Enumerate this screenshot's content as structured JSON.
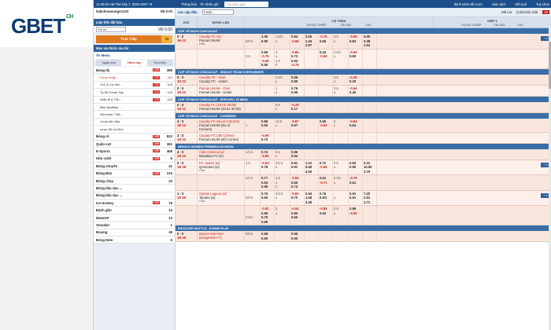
{
  "brand": {
    "name": "GBET",
    "domain": ".CH"
  },
  "topbar": {
    "time": "11:26:00 AM Thứ bảy 7, 2025 GMT +8",
    "notice_label": "Thông báo",
    "notice_text": "Tin nhắn gửi",
    "search_placeholder": "Tìm kiếm giải",
    "links": [
      "danh sách đã cược",
      "Giao dịch",
      "Kết quả",
      "Tuỳ chọn"
    ]
  },
  "sidebar": {
    "username": "0abchoamungen123",
    "balance": "VĐ 0.00",
    "credit_label": "Tín cực",
    "bet_slip_title": "Làm tiền đặt bảo",
    "bet_select": "Tối cả",
    "bet_amount": "VĐ 0.00",
    "bet_button": "Trực Tiếp",
    "bet_count": "30",
    "fav_title": "Mục ưu thích của tôi",
    "menu_title": "Ẩn Menu",
    "tabs": [
      "Ngày mai",
      "Hôm nay",
      "Trực tiếp"
    ],
    "sports": [
      {
        "name": "Bóng đá",
        "live": "LIVE",
        "count": "389",
        "style": "bold"
      },
      {
        "name": "Cược chấp ...",
        "live": "LIVE",
        "count": "334",
        "style": "sub hl"
      },
      {
        "name": "1X2 & Cơ Hội ...",
        "live": "LIVE",
        "count": "116",
        "style": "sub"
      },
      {
        "name": "Tỷ Số Chính Xác",
        "live": "LIVE",
        "count": "119",
        "style": "sub"
      },
      {
        "name": "chẵn lẻ & Tổn ...",
        "live": "LIVE",
        "count": "123",
        "style": "sub"
      },
      {
        "name": "Bàn đầu/Bàn ...",
        "live": "",
        "count": "",
        "style": "sub"
      },
      {
        "name": "Nửa trận / Toả...",
        "live": "",
        "count": "",
        "style": "sub"
      },
      {
        "name": "Cược liên tiếp",
        "live": "",
        "count": "",
        "style": "sub"
      },
      {
        "name": "cược đôi và đích",
        "live": "",
        "count": "",
        "style": "sub"
      },
      {
        "name": "Bóng rổ",
        "live": "LIVE",
        "count": "822",
        "style": "bold"
      },
      {
        "name": "Quần vợt",
        "live": "LIVE",
        "count": "361",
        "style": "bold"
      },
      {
        "name": "E-Sports",
        "live": "LIVE",
        "count": "465",
        "style": "bold"
      },
      {
        "name": "Hôn cnkê",
        "live": "LIVE",
        "count": "6",
        "style": "bold"
      },
      {
        "name": "Bóng chuyền",
        "live": "",
        "count": "41",
        "style": "bold"
      },
      {
        "name": "Bóng Bàn",
        "live": "LIVE",
        "count": "215",
        "style": "bold"
      },
      {
        "name": "Bóng chày",
        "live": "",
        "count": "22",
        "style": "bold"
      },
      {
        "name": "Bóng bầu dục ...",
        "live": "",
        "count": "",
        "style": "bold"
      },
      {
        "name": "Bóng bầu dục ...",
        "live": "",
        "count": "",
        "style": "bold"
      },
      {
        "name": "Ice Hockey",
        "live": "LIVE",
        "count": "76",
        "style": "bold"
      },
      {
        "name": "Đánh gôn",
        "live": "",
        "count": "14",
        "style": "bold"
      },
      {
        "name": "MotoGP",
        "live": "",
        "count": "13",
        "style": "bold"
      },
      {
        "name": "Snooker",
        "live": "",
        "count": "1",
        "style": "bold"
      },
      {
        "name": "Boxing",
        "live": "",
        "count": "45",
        "style": "bold"
      },
      {
        "name": "Bóng Ném",
        "live": "",
        "count": "5",
        "style": "bold"
      }
    ]
  },
  "main": {
    "filter_title": "các cặp đấu",
    "filter_select": "Cược...",
    "sort_label": "Mã Lai",
    "count_text": "(132/132) Giải",
    "badge": "19",
    "header": {
      "time": "GIỜ",
      "team": "BÓNG LĂN",
      "full_match": "CẢ TRẬN",
      "first_half": "HIỆP 1",
      "sub": [
        "CƯỢC CHẤP",
        "TÀI XỈU",
        "1X2",
        "CƯỢC CHẤP",
        "TÀI XỈU",
        "1X2"
      ]
    },
    "leagues": [
      {
        "name": "CÚP VÔ ĐỊCH CONCACAF",
        "matches": [
          {
            "score": "0 : 0",
            "min": "1H 22",
            "home": "Cavalry FC (N)",
            "away": "Pumas UNAM",
            "draw": "Hòa",
            "cols": [
              [
                "",
                "0/0.5",
                ""
              ],
              [
                "1.00",
                "0.90",
                ""
              ],
              [
                "1.5/2",
                "u",
                ""
              ],
              [
                "0.84",
                "-0.96",
                ""
              ],
              [
                "3.25",
                "2.26",
                "2.87"
              ],
              [
                "-0.75",
                "0.65",
                ""
              ],
              [
                "0.5",
                "u",
                ""
              ],
              [
                "-0.85",
                "0.83",
                ""
              ],
              [
                "5.00",
                "3.38",
                "1.63"
              ]
            ],
            "more": "+ 6"
          },
          {
            "score": "",
            "min": "",
            "home": "",
            "away": "",
            "draw": "",
            "cols": [
              [
                "",
                "0.5",
                "",
                ""
              ],
              [
                "0.69",
                "-0.75",
                "-0.65",
                "0.55"
              ],
              [
                "3",
                "u",
                "1.5",
                "0"
              ],
              [
                "-0.85",
                "0.73",
                "0.64",
                "-0.76"
              ],
              [
                "",
                "",
                "",
                ""
              ],
              [
                "0.44",
                "-0.54",
                ""
              ],
              [
                "0.5/1",
                "u",
                ""
              ],
              [
                "-0.62",
                "0.50",
                ""
              ],
              [
                "",
                "",
                ""
              ]
            ],
            "more": ""
          }
        ]
      },
      {
        "name": "CÚP VÔ ĐỊCH CONCACAF - SINGLE TEAM OVER/UNDER",
        "matches": [
          {
            "score": "0 : 0",
            "min": "1H 22",
            "home": "Cavalry FC - Over",
            "away": "Cavalry FC - Under",
            "draw": "",
            "cols": [
              [
                "",
                ""
              ],
              [
                "",
                ""
              ],
              [
                "0.5/1",
                "u"
              ],
              [
                "0.96",
                "0.80"
              ],
              [
                "",
                ""
              ],
              [
                "",
                ""
              ],
              [
                "0.5",
                "u"
              ],
              [
                "-0.49",
                "0.25"
              ],
              [
                "",
                ""
              ]
            ],
            "more": ""
          },
          {
            "score": "0 : 0",
            "min": "1H 22",
            "home": "Pumas UNAM - Over",
            "away": "Pumas UNAM - Under",
            "draw": "",
            "cols": [
              [
                "",
                ""
              ],
              [
                "",
                ""
              ],
              [
                "1",
                "u"
              ],
              [
                "0.76",
                "0.96"
              ],
              [
                "",
                ""
              ],
              [
                "",
                ""
              ],
              [
                "0.5",
                "u"
              ],
              [
                "-0.64",
                "0.40"
              ],
              [
                "",
                ""
              ]
            ],
            "more": ""
          }
        ]
      },
      {
        "name": "CÚP VÔ ĐỊCH CONCACAF - SPECIFIC 15 MINS",
        "matches": [
          {
            "score": "0 : 0",
            "min": "1H 22",
            "home": "Cavalry FC (15:01-30:00)",
            "away": "Pumas UNAM (15:01-30:00)",
            "draw": "",
            "cols": [
              [
                "",
                ""
              ],
              [
                "",
                ""
              ],
              [
                "0.5",
                "u"
              ],
              [
                "-0.29",
                "0.17"
              ],
              [
                "",
                ""
              ],
              [
                "",
                ""
              ],
              [
                "",
                ""
              ],
              [
                "",
                ""
              ],
              [
                "",
                ""
              ]
            ],
            "more": ""
          }
        ]
      },
      {
        "name": "CÚP VÔ ĐỊCH CONCACAF - CORNERS",
        "matches": [
          {
            "score": "3 : 0",
            "min": "1H 22",
            "home": "Cavalry FC (No.of Corners)",
            "away": "Pumas UNAM (No.of Corners)",
            "draw": "",
            "cols": [
              [
                "",
                "1"
              ],
              [
                "0.86",
                "0.92"
              ],
              [
                "10.5",
                "u"
              ],
              [
                "-0.87",
                "0.67"
              ],
              [
                "",
                ""
              ],
              [
                "0.95",
                "-0.83"
              ],
              [
                "5",
                "u"
              ],
              [
                "-0.84",
                "0.64"
              ],
              [
                "",
                ""
              ]
            ],
            "more": ""
          },
          {
            "score": "2 : 0",
            "min": "1H 22",
            "home": "Cavalry FC (4th Corner)",
            "away": "Pumas UNAM (4th Corner)",
            "draw": "",
            "cols": [
              [
                "",
                ""
              ],
              [
                "-0.90",
                "0.70"
              ],
              [
                "",
                ""
              ],
              [
                "",
                ""
              ],
              [
                "",
                ""
              ],
              [
                "",
                ""
              ],
              [
                "",
                ""
              ],
              [
                "",
                ""
              ],
              [
                "",
                ""
              ]
            ],
            "more": ""
          }
        ]
      },
      {
        "name": "MEXICO WOMEN PRIMERA DIVISION",
        "matches": [
          {
            "score": "4 : 0",
            "min": "2H 24",
            "home": "Club America (w)",
            "away": "Mazatlan FC (w)",
            "draw": "",
            "cols": [
              [
                "1/1.5",
                ""
              ],
              [
                "0.74",
                "-0.96"
              ],
              [
                "5.5",
                "u"
              ],
              [
                "0.86",
                "0.94"
              ],
              [
                "",
                ""
              ],
              [
                "",
                ""
              ],
              [
                "",
                ""
              ],
              [
                "",
                ""
              ],
              [
                "",
                ""
              ]
            ],
            "more": ""
          },
          {
            "score": "0 : 0",
            "min": "1H 26",
            "home": "FC Juarez (w)",
            "away": "Queretaro (w)",
            "draw": "Hòa",
            "cols": [
              [
                "1.5",
                ""
              ],
              [
                "-0.94",
                "0.78"
              ],
              [
                "2/2.5",
                "u"
              ],
              [
                "0.91",
                "0.91"
              ],
              [
                "1.31",
                "9.60",
                "4.00"
              ],
              [
                "0.72",
                "-0.88"
              ],
              [
                "0.5",
                "u"
              ],
              [
                "0.92",
                "0.90"
              ],
              [
                "2.31",
                "10.00",
                "1.70"
              ]
            ],
            "more": "+ 4"
          },
          {
            "score": "",
            "min": "",
            "home": "",
            "away": "",
            "draw": "",
            "cols": [
              [
                "1/1.5",
                "",
                ""
              ],
              [
                "0.77",
                "0.53",
                "0.95"
              ],
              [
                "2.5",
                "u",
                "2"
              ],
              [
                "-0.83",
                "0.65",
                "0.73"
              ],
              [
                "",
                "",
                ""
              ],
              [
                "0.51",
                "-0.71",
                ""
              ],
              [
                "0.5/1",
                "u",
                ""
              ],
              [
                "-0.79",
                "0.61",
                ""
              ],
              [
                "",
                "",
                ""
              ]
            ],
            "more": ""
          },
          {
            "score": "1 : 0",
            "min": "1H 20",
            "home": "Santos Laguna (w)",
            "away": "Tijuana (w)",
            "draw": "Hòa",
            "cols": [
              [
                "",
                "0/0.5"
              ],
              [
                "0.76",
                "0.94"
              ],
              [
                "2/2.5",
                "u"
              ],
              [
                "-0.82",
                "0.70"
              ],
              [
                "0.94",
                "1.58",
                "3.40"
              ],
              [
                "0.76",
                "0.5/1"
              ],
              [
                "",
                "u"
              ],
              [
                "0.91",
                "0.91"
              ],
              [
                "7.20",
                "2.51",
                "1.71"
              ]
            ],
            "more": "+ 4"
          },
          {
            "score": "",
            "min": "",
            "home": "",
            "away": "",
            "draw": "",
            "cols": [
              [
                "",
                "",
                "0.5/1",
                ""
              ],
              [
                "-0.91",
                "0.56",
                "0.75",
                "0.99"
              ],
              [
                "3",
                "u",
                "",
                ""
              ],
              [
                "-0.94",
                "0.83",
                "0.60",
                ""
              ],
              [
                "",
                "",
                "",
                ""
              ],
              [
                "-0.85",
                "0.93",
                ""
              ],
              [
                "0.5",
                "u",
                ""
              ],
              [
                "0.96",
                "-0.50",
                ""
              ],
              [
                "",
                "",
                ""
              ]
            ],
            "more": ""
          }
        ]
      },
      {
        "name": "ESOCCER BATTLE - 8 MINS PLAY",
        "matches": [
          {
            "score": "0 : 0",
            "min": "1H 05",
            "home": "Bayern Munchen (DangerDim77)",
            "away": "",
            "draw": "",
            "cols": [
              [
                "0/0.5",
                ""
              ],
              [
                "0.98",
                "0.90"
              ],
              [
                "",
                ""
              ],
              [
                "0.95",
                "0.93"
              ],
              [
                "",
                ""
              ],
              [
                "",
                ""
              ],
              [
                "",
                ""
              ],
              [
                "",
                ""
              ],
              [
                "",
                ""
              ]
            ],
            "more": ""
          }
        ]
      }
    ]
  }
}
